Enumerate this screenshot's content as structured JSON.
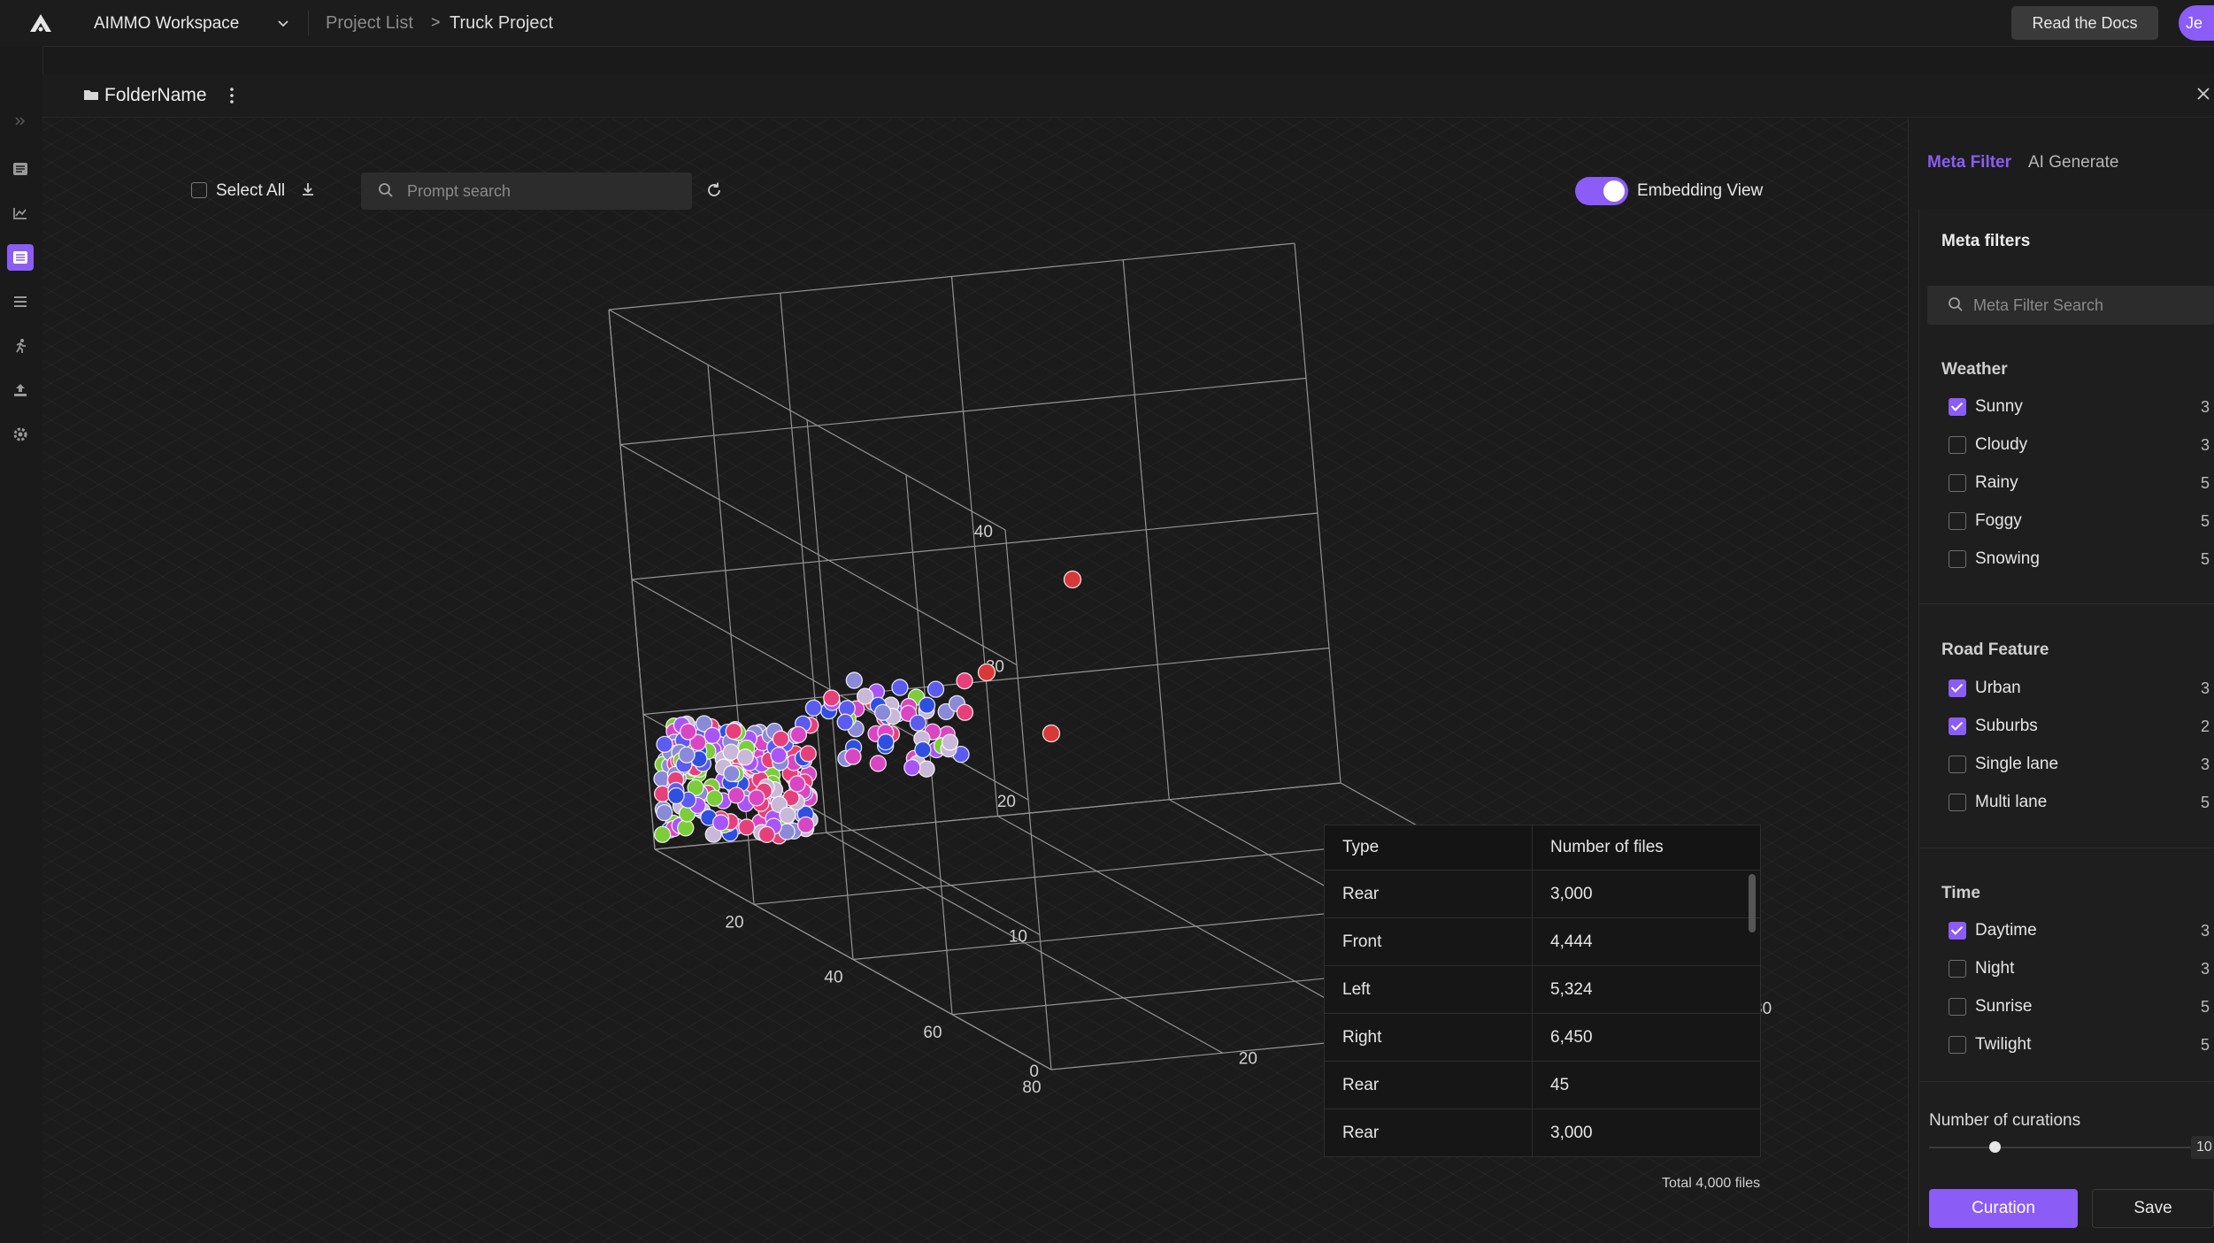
{
  "colors": {
    "accent": "#8b5cf6",
    "background": "#1b1b1b",
    "panel": "#1c1c1c"
  },
  "topbar": {
    "logo_icon": "aimmo-logo-icon",
    "workspace": "AIMMO Workspace",
    "breadcrumb": [
      "Project List",
      ">",
      "Truck Project"
    ],
    "docs_button": "Read the Docs",
    "avatar_initials": "Je"
  },
  "leftrail": {
    "icons": [
      "expand-icon",
      "list-icon",
      "chart-icon",
      "dataset-icon",
      "menu-icon",
      "run-icon",
      "upload-icon",
      "settings-icon"
    ],
    "active": "dataset-icon"
  },
  "folder": {
    "name": "FolderName"
  },
  "toolbar": {
    "select_all": "Select All",
    "search_placeholder": "Prompt search",
    "embedding_view_label": "Embedding View",
    "embedding_view_on": true
  },
  "chart_data": {
    "type": "scatter3d",
    "axes": {
      "vertical": {
        "ticks": [
          0,
          10,
          20,
          30,
          40
        ],
        "range": [
          0,
          40
        ]
      },
      "left_floor": {
        "ticks": [
          20,
          40,
          60,
          80
        ],
        "range": [
          0,
          80
        ]
      },
      "right_floor": {
        "ticks": [
          20,
          40,
          60,
          80
        ],
        "range": [
          0,
          80
        ]
      }
    },
    "cluster_colors": [
      "#e6407a",
      "#d946c4",
      "#5b5bf0",
      "#8a8ad8",
      "#7ccd3a",
      "#a855f7",
      "#c9b8d8",
      "#2f4fe0"
    ],
    "outliers": [
      {
        "color": "#d93838",
        "label": "outlier-high"
      },
      {
        "color": "#d93838",
        "label": "outlier-mid"
      },
      {
        "color": "#d93838",
        "label": "outlier-low"
      }
    ]
  },
  "table": {
    "headers": [
      "Type",
      "Number of files"
    ],
    "rows": [
      [
        "Rear",
        "3,000"
      ],
      [
        "Front",
        "4,444"
      ],
      [
        "Left",
        "5,324"
      ],
      [
        "Right",
        "6,450"
      ],
      [
        "Rear",
        "45"
      ],
      [
        "Rear",
        "3,000"
      ]
    ],
    "total": "Total 4,000 files"
  },
  "rightpanel": {
    "tabs": [
      "Meta Filter",
      "AI Generate"
    ],
    "title": "Meta filters",
    "search_placeholder": "Meta Filter Search",
    "sections": [
      {
        "title": "Weather",
        "items": [
          {
            "label": "Sunny",
            "checked": true,
            "count": "3"
          },
          {
            "label": "Cloudy",
            "checked": false,
            "count": "3"
          },
          {
            "label": "Rainy",
            "checked": false,
            "count": "5"
          },
          {
            "label": "Foggy",
            "checked": false,
            "count": "5"
          },
          {
            "label": "Snowing",
            "checked": false,
            "count": "5"
          }
        ]
      },
      {
        "title": "Road Feature",
        "items": [
          {
            "label": "Urban",
            "checked": true,
            "count": "3"
          },
          {
            "label": "Suburbs",
            "checked": true,
            "count": "2"
          },
          {
            "label": "Single lane",
            "checked": false,
            "count": "3"
          },
          {
            "label": "Multi lane",
            "checked": false,
            "count": "5"
          }
        ]
      },
      {
        "title": "Time",
        "items": [
          {
            "label": "Daytime",
            "checked": true,
            "count": "3"
          },
          {
            "label": "Night",
            "checked": false,
            "count": "3"
          },
          {
            "label": "Sunrise",
            "checked": false,
            "count": "5"
          },
          {
            "label": "Twilight",
            "checked": false,
            "count": "5"
          }
        ]
      }
    ],
    "curations_label": "Number of curations",
    "curations_value": "10",
    "curations_fraction": 0.25,
    "curation_button": "Curation",
    "save_button": "Save"
  }
}
